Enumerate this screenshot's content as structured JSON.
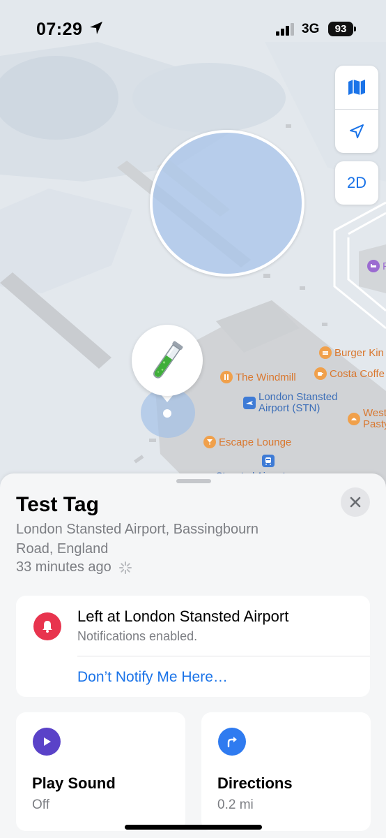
{
  "status_bar": {
    "time": "07:29",
    "network": "3G",
    "battery": "93"
  },
  "map": {
    "controls": {
      "map_icon": "map-icon",
      "location_icon": "location-arrow-icon",
      "mode_label": "2D"
    },
    "pois": {
      "burger_king": "Burger Kin",
      "the_windmill": "The Windmill",
      "costa": "Costa Coffe",
      "airport_line1": "London Stansted",
      "airport_line2": "Airport (STN)",
      "west_line1": "West",
      "west_line2": "Pasty",
      "escape_lounge": "Escape Lounge",
      "station": "Stansted Airport",
      "hotel": "P"
    },
    "pin_emoji": "test-tube-icon"
  },
  "sheet": {
    "title": "Test Tag",
    "address": "London Stansted Airport, Bassingbourn Road, England",
    "updated": "33 minutes ago",
    "notification": {
      "title": "Left at London Stansted Airport",
      "subtitle": "Notifications enabled.",
      "link": "Don’t Notify Me Here…"
    },
    "actions": {
      "play_sound": {
        "label": "Play Sound",
        "value": "Off"
      },
      "directions": {
        "label": "Directions",
        "value": "0.2 mi"
      }
    }
  },
  "colors": {
    "accent_blue": "#1a73e8",
    "alert_red": "#e8344e",
    "play_purple": "#5a42c8",
    "directions_blue": "#2f7bf0",
    "poi_orange": "#d9772e",
    "airport_blue": "#3d6fb8"
  }
}
